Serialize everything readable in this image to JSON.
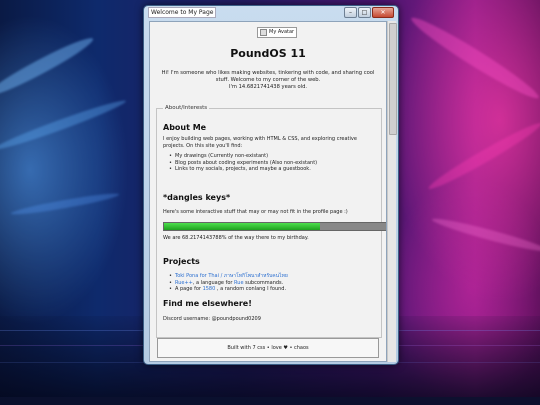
{
  "window": {
    "title": "Welcome to My Page",
    "buttons": {
      "minimize": "–",
      "maximize": "□",
      "close": "✕"
    }
  },
  "page": {
    "avatar_alt": "My Avatar",
    "site_title": "PoundOS 11",
    "intro_line1": "Hi! I'm someone who likes making websites, tinkering with code, and sharing cool stuff. Welcome to my corner of the web.",
    "intro_line2": "I'm 14.6821741438 years old.",
    "section_legend": "About/Interests",
    "about": {
      "heading": "About Me",
      "text": "I enjoy building web pages, working with HTML & CSS, and exploring creative projects. On this site you'll find:",
      "items": [
        "My drawings (Currently non-existant)",
        "Blog posts about coding experiments (Also non-existant)",
        "Links to my socials, projects, and maybe a guestbook."
      ]
    },
    "dangles": {
      "heading": "*dangles keys*",
      "text": "Here's some interactive stuff that may or may not fit in the profile page :)",
      "progress_percent": 68.2174143788,
      "progress_text": "We are 68.2174143788% of the way there to my birthday."
    },
    "projects": {
      "heading": "Projects",
      "item1_link": "Toki Pona for Thai / ภาษาโทกิโพนาสำหรับคนไทย",
      "item2_link": "Rue++",
      "item2_mid": ", a language for",
      "item2_link2": "Rue",
      "item2_end": "subcommands.",
      "item3_start": "A page for",
      "item3_link": "1580",
      "item3_end": ", a random conlang I found."
    },
    "elsewhere": {
      "heading": "Find me elsewhere!",
      "discord": "Discord username: @poundpound0209"
    },
    "footer": "Built with 7 css • love ♥ • chaos"
  },
  "colors": {
    "accent_link": "#2b6fd0",
    "progress_fill": "#2bbf2b"
  }
}
